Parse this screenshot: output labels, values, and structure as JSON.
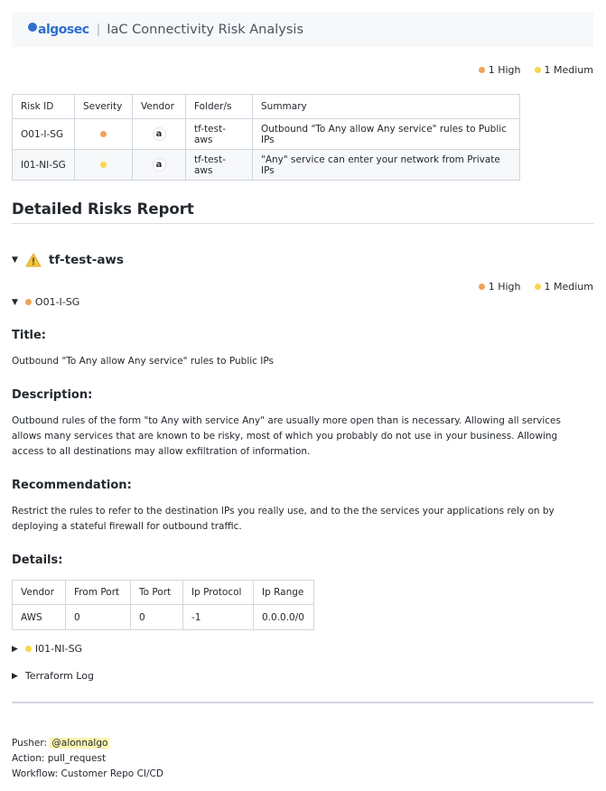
{
  "header": {
    "logo_text": "algosec",
    "title": "IaC Connectivity Risk Analysis"
  },
  "counts": {
    "high": "1 High",
    "medium": "1 Medium"
  },
  "summary_table": {
    "headers": [
      "Risk ID",
      "Severity",
      "Vendor",
      "Folder/s",
      "Summary"
    ],
    "rows": [
      {
        "risk_id": "O01-I-SG",
        "severity": "high",
        "vendor_icon": "amazon-icon",
        "vendor_glyph": "a",
        "folder": "tf-test-aws",
        "summary": "Outbound \"To Any allow Any service\" rules to Public IPs"
      },
      {
        "risk_id": "I01-NI-SG",
        "severity": "medium",
        "vendor_icon": "amazon-icon",
        "vendor_glyph": "a",
        "folder": "tf-test-aws",
        "summary": "\"Any\" service can enter your network from Private IPs"
      }
    ]
  },
  "report": {
    "heading": "Detailed Risks Report",
    "folder": "tf-test-aws",
    "risk": {
      "id": "O01-I-SG",
      "title_label": "Title:",
      "title": "Outbound \"To Any allow Any service\" rules to Public IPs",
      "description_label": "Description:",
      "description": "Outbound rules of the form \"to Any with service Any\" are usually more open than is necessary. Allowing all services allows many services that are known to be risky, most of which you probably do not use in your business. Allowing access to all destinations may allow exfiltration of information.",
      "recommendation_label": "Recommendation:",
      "recommendation": "Restrict the rules to refer to the destination IPs you really use, and to the the services your applications rely on by deploying a stateful firewall for outbound traffic.",
      "details_label": "Details:",
      "details_table": {
        "headers": [
          "Vendor",
          "From Port",
          "To Port",
          "Ip Protocol",
          "Ip Range"
        ],
        "rows": [
          [
            "AWS",
            "0",
            "0",
            "-1",
            "0.0.0.0/0"
          ]
        ]
      }
    },
    "collapsed_risk": "I01-NI-SG",
    "terraform_log": "Terraform Log"
  },
  "footer": {
    "pusher_label": "Pusher: ",
    "pusher": "@alonnalgo",
    "action": "Action: pull_request",
    "workflow": "Workflow: Customer Repo CI/CD"
  },
  "colors": {
    "high": "#f0a259",
    "medium": "#fad54a",
    "brand": "#2f6fd1",
    "warning": "#f5c342"
  }
}
